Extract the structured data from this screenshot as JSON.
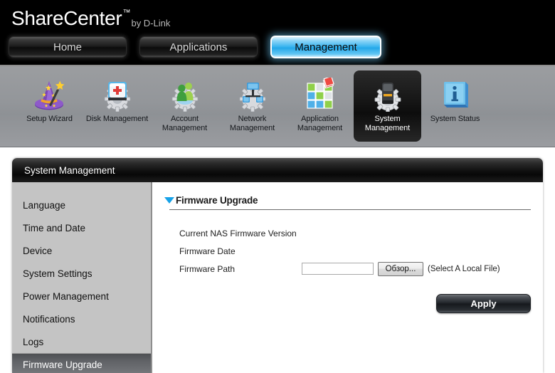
{
  "header": {
    "brand_name": "ShareCenter",
    "brand_tm": "™",
    "brand_by": "by D-Link",
    "nav": [
      {
        "label": "Home",
        "active": false
      },
      {
        "label": "Applications",
        "active": false
      },
      {
        "label": "Management",
        "active": true
      }
    ]
  },
  "toolbar": {
    "items": [
      {
        "label": "Setup Wizard",
        "icon": "wizard-hat-icon",
        "selected": false
      },
      {
        "label": "Disk\nManagement",
        "icon": "disk-medkit-gear-icon",
        "selected": false
      },
      {
        "label": "Account\nManagement",
        "icon": "account-people-gear-icon",
        "selected": false
      },
      {
        "label": "Network\nManagement",
        "icon": "network-gear-icon",
        "selected": false
      },
      {
        "label": "Application\nManagement",
        "icon": "application-tiles-icon",
        "selected": false
      },
      {
        "label": "System\nManagement",
        "icon": "system-gear-icon",
        "selected": true
      },
      {
        "label": "System Status",
        "icon": "info-box-icon",
        "selected": false
      }
    ]
  },
  "panel": {
    "title": "System Management"
  },
  "sidebar": {
    "items": [
      {
        "label": "Language",
        "active": false
      },
      {
        "label": "Time and Date",
        "active": false
      },
      {
        "label": "Device",
        "active": false
      },
      {
        "label": "System Settings",
        "active": false
      },
      {
        "label": "Power Management",
        "active": false
      },
      {
        "label": "Notifications",
        "active": false
      },
      {
        "label": "Logs",
        "active": false
      },
      {
        "label": "Firmware Upgrade",
        "active": true
      }
    ]
  },
  "main": {
    "section_title": "Firmware Upgrade",
    "rows": [
      {
        "label": "Current NAS Firmware Version",
        "value": ""
      },
      {
        "label": "Firmware Date",
        "value": ""
      },
      {
        "label": "Firmware Path",
        "value": ""
      }
    ],
    "firmware_path_value": "",
    "firmware_path_placeholder": "",
    "browse_label": "Обзор...",
    "browse_hint": "(Select A Local File)",
    "apply_label": "Apply"
  },
  "colors": {
    "accent_blue": "#16a2e8",
    "tab_active": "#36b3ef",
    "panel_header": "#0e0e0e",
    "sidebar_bg": "#c4c4c4"
  }
}
